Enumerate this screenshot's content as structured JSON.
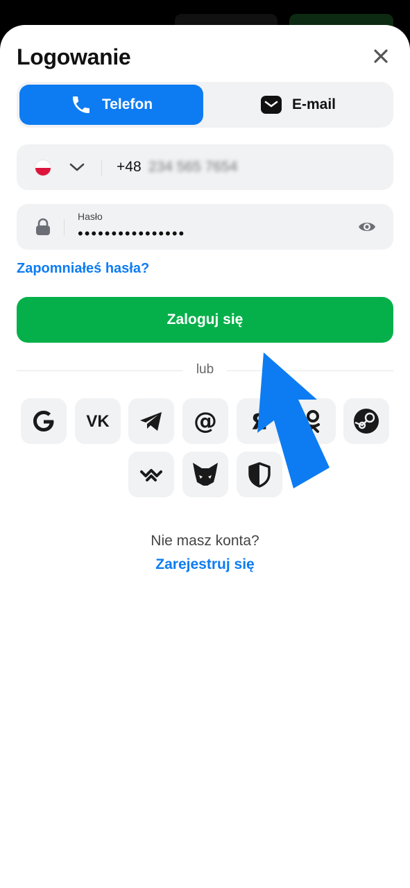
{
  "modal": {
    "title": "Logowanie"
  },
  "tabs": [
    {
      "label": "Telefon",
      "icon": "phone-icon",
      "active": true
    },
    {
      "label": "E-mail",
      "icon": "envelope-icon",
      "active": false
    }
  ],
  "phone_field": {
    "country_flag": "poland-flag-icon",
    "prefix": "+48",
    "number": "234 565 7654"
  },
  "password_field": {
    "label": "Hasło",
    "value": "••••••••••••••••"
  },
  "forgot_password": "Zapomniałeś hasła?",
  "login_button": "Zaloguj się",
  "separator": "lub",
  "social_logins": [
    "google-icon",
    "vk-icon",
    "telegram-icon",
    "mail-at-icon",
    "yandex-icon",
    "odnoklassniki-icon",
    "steam-icon",
    "walletconnect-icon",
    "metamask-fox-icon",
    "shield-icon"
  ],
  "no_account_text": "Nie masz konta?",
  "register_link": "Zarejestruj się",
  "colors": {
    "accent_blue": "#0d7cf2",
    "login_green": "#05b04a",
    "field_bg": "#f1f2f4"
  }
}
